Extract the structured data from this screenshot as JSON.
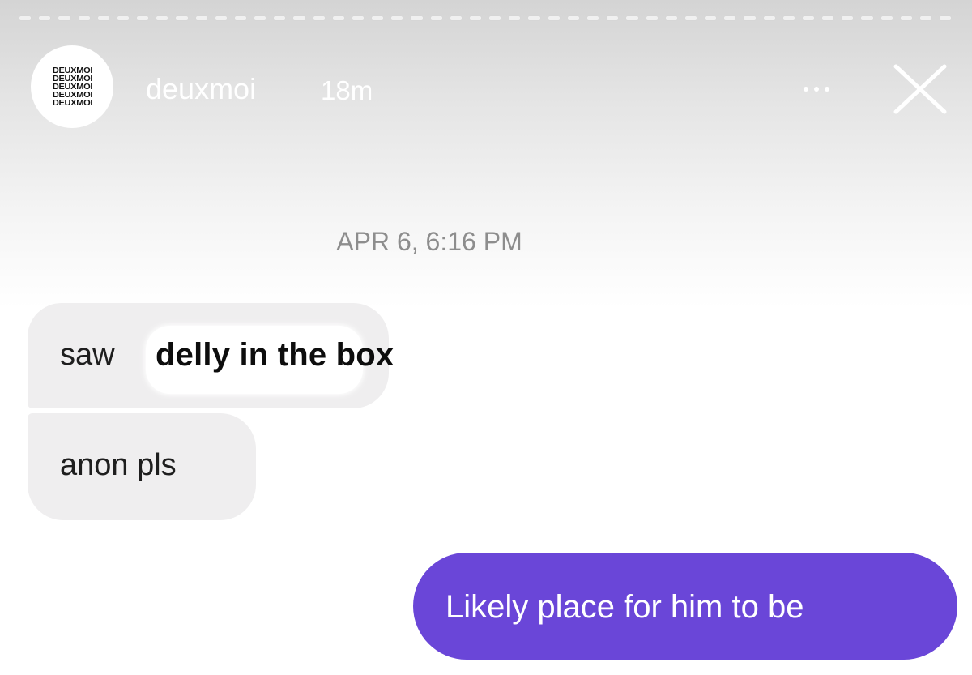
{
  "story_header": {
    "avatar_lines": [
      "DEUXMOI",
      "DEUXMOI",
      "DEUXMOI",
      "DEUXMOI",
      "DEUXMOI"
    ],
    "username": "deuxmoi",
    "time_ago": "18m",
    "more_icon": "ellipsis-icon",
    "close_icon": "close-icon"
  },
  "conversation": {
    "date_stamp": "APR 6, 6:16 PM",
    "messages": [
      {
        "direction": "incoming",
        "text": "saw"
      },
      {
        "direction": "incoming",
        "text": "anon pls"
      },
      {
        "direction": "outgoing",
        "text": "Likely place for him to be"
      }
    ],
    "overlay_text": "delly in the box"
  },
  "colors": {
    "outgoing_bubble": "#6a46d8",
    "incoming_bubble": "#efeeef",
    "header_text": "#ffffff",
    "date_text": "#8d8d8d"
  }
}
